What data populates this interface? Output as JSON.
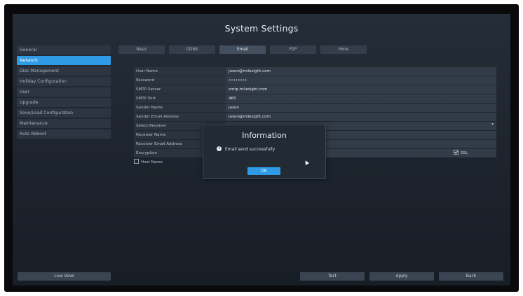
{
  "window": {
    "title": "System Settings"
  },
  "sidebar": {
    "items": [
      {
        "label": "General"
      },
      {
        "label": "Network"
      },
      {
        "label": "Disk Management"
      },
      {
        "label": "Holiday Configuration"
      },
      {
        "label": "User"
      },
      {
        "label": "Upgrade"
      },
      {
        "label": "Save/Load Configuration"
      },
      {
        "label": "Maintenance"
      },
      {
        "label": "Auto Reboot"
      }
    ],
    "active_index": 1,
    "live_view_label": "Live View"
  },
  "tabs": [
    {
      "label": "Basic"
    },
    {
      "label": "DDNS"
    },
    {
      "label": "Email"
    },
    {
      "label": "P2P"
    },
    {
      "label": "More"
    }
  ],
  "active_tab_index": 2,
  "form": {
    "user_name": {
      "label": "User Name",
      "value": "jason@milesight.com"
    },
    "password": {
      "label": "Password",
      "value": "••••••••"
    },
    "smtp_server": {
      "label": "SMTP Server",
      "value": "smtp.milesight.com"
    },
    "smtp_port": {
      "label": "SMTP Port",
      "value": "465"
    },
    "sender_name": {
      "label": "Sender Name",
      "value": "jason"
    },
    "sender_email": {
      "label": "Sender Email Address",
      "value": "jason@milesight.com"
    },
    "select_receiver": {
      "label": "Select Receiver",
      "value": ""
    },
    "receiver_name": {
      "label": "Receiver Name",
      "value": ""
    },
    "receiver_email": {
      "label": "Receiver Email Address",
      "value": ""
    },
    "encryption": {
      "label": "Encryption",
      "ssl_label": "SSL",
      "ssl_checked": true
    },
    "host_name": {
      "label": "Host Name",
      "checked": false
    }
  },
  "buttons": {
    "test": "Test",
    "apply": "Apply",
    "back": "Back"
  },
  "dialog": {
    "title": "Information",
    "message": "Email send successfully",
    "ok_label": "OK"
  },
  "colors": {
    "accent": "#2f9be6",
    "background": "#1e252e"
  }
}
